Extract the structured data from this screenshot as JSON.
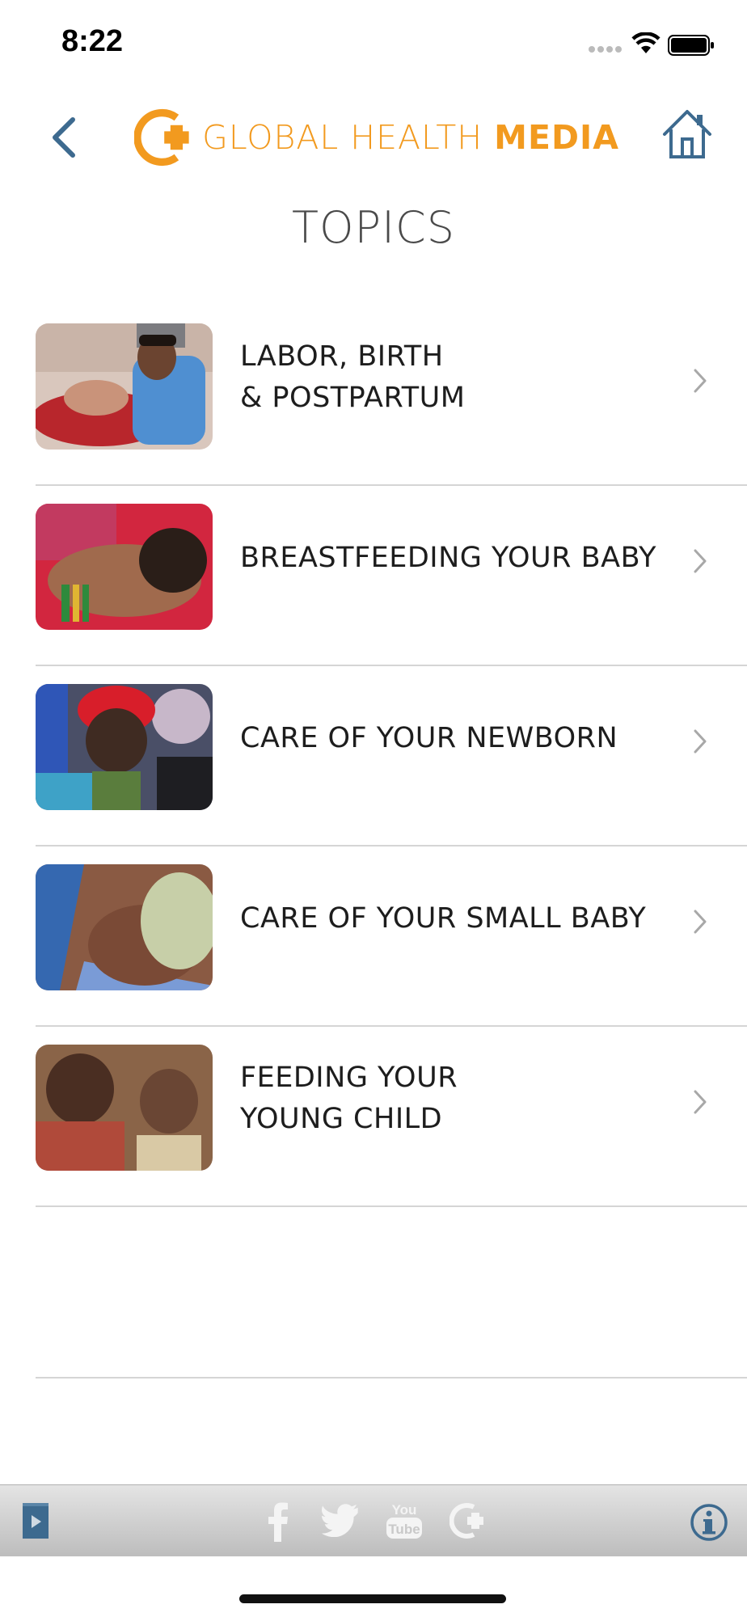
{
  "status_bar": {
    "time": "8:22"
  },
  "header": {
    "logo_text_regular": "GLOBAL HEALTH ",
    "logo_text_bold": "MEDIA"
  },
  "page": {
    "title": "TOPICS"
  },
  "topics": [
    {
      "label": "LABOR, BIRTH\n& POSTPARTUM",
      "image": "mother-in-labor-photo"
    },
    {
      "label": "BREASTFEEDING YOUR BABY",
      "image": "breastfeeding-photo"
    },
    {
      "label": "CARE OF YOUR NEWBORN",
      "image": "newborn-photo"
    },
    {
      "label": "CARE OF YOUR SMALL BABY",
      "image": "small-baby-photo"
    },
    {
      "label": "FEEDING YOUR\nYOUNG CHILD",
      "image": "feeding-child-photo"
    }
  ],
  "icons": {
    "back": "chevron-left-icon",
    "home": "home-icon",
    "row_chevron": "chevron-right-icon",
    "tabbar": [
      "video-library-icon",
      "facebook-icon",
      "twitter-icon",
      "youtube-icon",
      "global-health-media-icon",
      "info-icon"
    ]
  },
  "colors": {
    "brand_orange": "#f29a1f",
    "nav_blue": "#3d6a8f",
    "tabbar_icon": "#f4f4f4"
  }
}
